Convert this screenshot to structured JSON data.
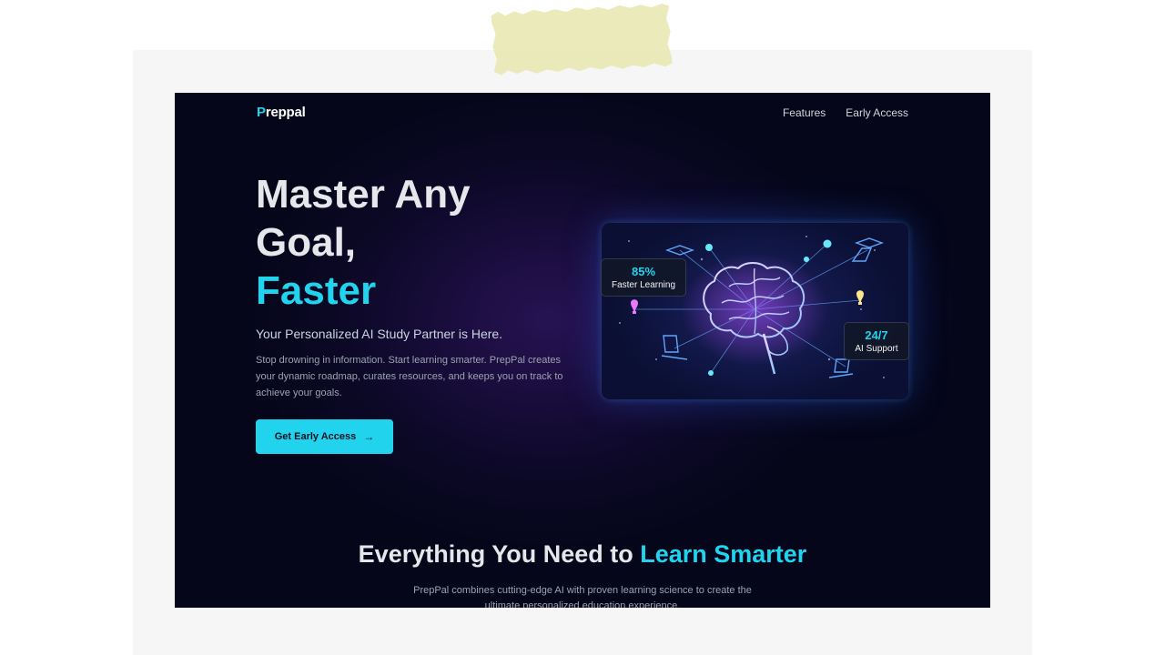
{
  "brand": {
    "logo_accent": "P",
    "logo_rest": "reppal",
    "accent_color": "#22d3ee",
    "bg_color": "#05061a"
  },
  "nav": {
    "items": [
      "Features",
      "Early Access"
    ]
  },
  "hero": {
    "title_line1": "Master Any",
    "title_line2": "Goal,",
    "title_accent": "Faster",
    "subheading": "Your Personalized AI Study Partner is Here.",
    "description": "Stop drowning in information. Start learning smarter. PrepPal creates your dynamic roadmap, curates resources, and keeps you on track to achieve your goals.",
    "cta_label": "Get Early Access",
    "cta_icon": "arrow-right-icon"
  },
  "illustration": {
    "subject": "brain-network-icon",
    "stats": [
      {
        "value": "85%",
        "label": "Faster Learning"
      },
      {
        "value": "24/7",
        "label": "AI Support"
      }
    ]
  },
  "features_section": {
    "title_plain": "Everything You Need to ",
    "title_accent": "Learn Smarter",
    "description": "PrepPal combines cutting-edge AI with proven learning science to create the ultimate personalized education experience."
  }
}
